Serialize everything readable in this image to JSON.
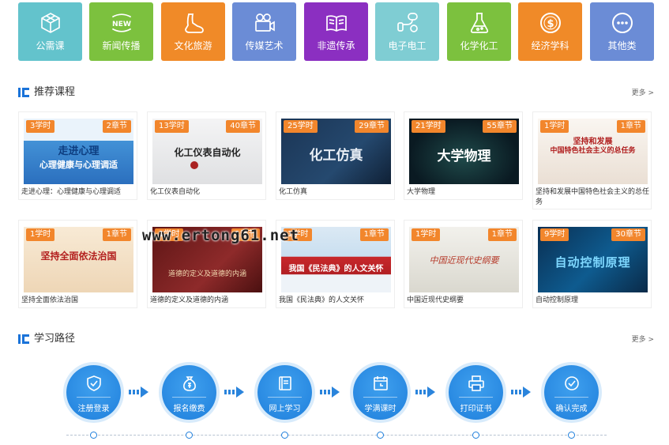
{
  "categories": [
    {
      "label": "公需课",
      "color": "#63c3cc",
      "icon": "cube-icon"
    },
    {
      "label": "新闻传播",
      "color": "#7cc13e",
      "icon": "new-badge-icon",
      "icon_text": "NEW"
    },
    {
      "label": "文化旅游",
      "color": "#f08a28",
      "icon": "shoe-icon"
    },
    {
      "label": "传媒艺术",
      "color": "#6b8cd6",
      "icon": "video-camera-icon"
    },
    {
      "label": "非遗传承",
      "color": "#8b2fc1",
      "icon": "book-icon"
    },
    {
      "label": "电子电工",
      "color": "#7fcdd3",
      "icon": "electric-plug-icon"
    },
    {
      "label": "化学化工",
      "color": "#7cc13e",
      "icon": "flask-icon"
    },
    {
      "label": "经济学科",
      "color": "#f08a28",
      "icon": "dollar-coin-icon",
      "icon_text": "$"
    },
    {
      "label": "其他类",
      "color": "#6b8cd6",
      "icon": "more-dots-icon"
    }
  ],
  "recommended": {
    "title": "推荐课程",
    "more": "更多 >",
    "courses": [
      {
        "title": "走进心理：心理健康与心理调适",
        "hours": "3学时",
        "chapters": "2章节",
        "thumb_text": [
          "走进心理",
          "心理健康与心理调适"
        ],
        "thumb_bg": "#3a8fd6"
      },
      {
        "title": "化工仪表自动化",
        "hours": "13学时",
        "chapters": "40章节",
        "thumb_text": [
          "化工仪表自动化"
        ],
        "thumb_bg": "#e9eaec"
      },
      {
        "title": "化工仿真",
        "hours": "25学时",
        "chapters": "29章节",
        "thumb_text": [
          "化工仿真"
        ],
        "thumb_bg": "#1d3a5c"
      },
      {
        "title": "大学物理",
        "hours": "21学时",
        "chapters": "55章节",
        "thumb_text": [
          "大学物理"
        ],
        "thumb_bg": "#0f2430"
      },
      {
        "title": "坚持和发展中国特色社会主义的总任务",
        "hours": "1学时",
        "chapters": "1章节",
        "thumb_text": [
          "坚持和发展",
          "中国特色社会主义的总任务"
        ],
        "thumb_bg": "#f3efe9"
      },
      {
        "title": "坚持全面依法治国",
        "hours": "1学时",
        "chapters": "1章节",
        "thumb_text": [
          "坚持全面依法治国"
        ],
        "thumb_bg": "#f6e7cf"
      },
      {
        "title": "道德的定义及道德的内涵",
        "hours": "1学时",
        "chapters": "1章节",
        "thumb_text": [
          "道德的定义及道德的内涵"
        ],
        "thumb_bg": "#7a1d1d"
      },
      {
        "title": "我国《民法典》的人文关怀",
        "hours": "1学时",
        "chapters": "1章节",
        "thumb_text": [
          "我国《民法典》的人文关怀"
        ],
        "thumb_bg": "#d8e8f3"
      },
      {
        "title": "中国近现代史纲要",
        "hours": "1学时",
        "chapters": "1章节",
        "thumb_text": [
          "中国近现代史纲要"
        ],
        "thumb_bg": "#e4e3dd"
      },
      {
        "title": "自动控制原理",
        "hours": "9学时",
        "chapters": "30章节",
        "thumb_text": [
          "自动控制原理"
        ],
        "thumb_bg": "#0b3f66"
      }
    ]
  },
  "path": {
    "title": "学习路径",
    "more": "更多 >",
    "steps": [
      {
        "label": "注册登录",
        "icon": "shield-check-icon"
      },
      {
        "label": "报名缴费",
        "icon": "money-bag-icon"
      },
      {
        "label": "网上学习",
        "icon": "book-icon"
      },
      {
        "label": "学满课时",
        "icon": "calendar-clock-icon"
      },
      {
        "label": "打印证书",
        "icon": "printer-icon"
      },
      {
        "label": "确认完成",
        "icon": "check-circle-icon"
      }
    ]
  },
  "watermark": "www.ertong61.net"
}
